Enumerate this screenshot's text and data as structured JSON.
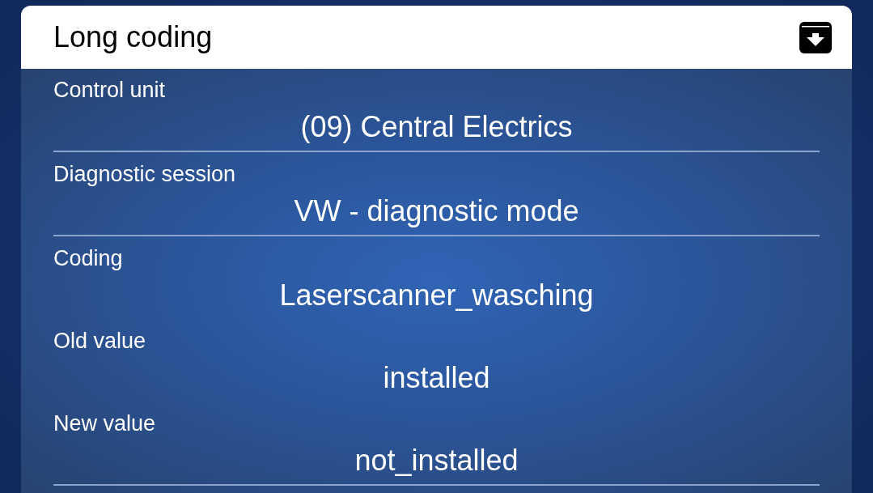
{
  "header": {
    "title": "Long coding"
  },
  "sections": [
    {
      "fields": [
        {
          "label": "Control unit",
          "value": "(09) Central Electrics"
        }
      ]
    },
    {
      "fields": [
        {
          "label": "Diagnostic session",
          "value": "VW - diagnostic mode"
        }
      ]
    },
    {
      "fields": [
        {
          "label": "Coding",
          "value": "Laserscanner_wasching"
        },
        {
          "label": "Old value",
          "value": "installed"
        },
        {
          "label": "New value",
          "value": "not_installed"
        }
      ]
    }
  ]
}
